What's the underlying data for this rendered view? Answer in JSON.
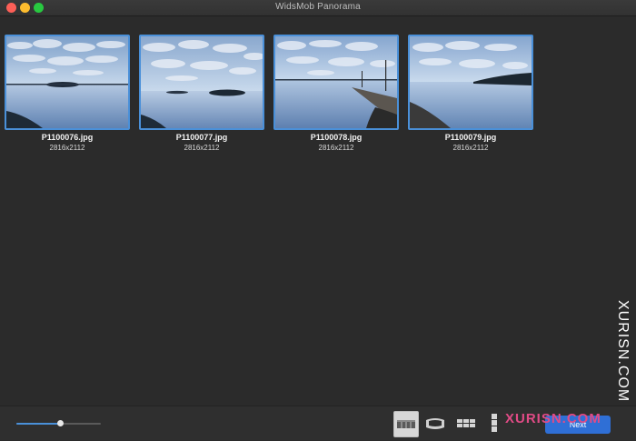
{
  "window": {
    "title": "WidsMob Panorama"
  },
  "photos": [
    {
      "filename": "P1100076.jpg",
      "dimensions": "2816x2112"
    },
    {
      "filename": "P1100077.jpg",
      "dimensions": "2816x2112"
    },
    {
      "filename": "P1100078.jpg",
      "dimensions": "2816x2112"
    },
    {
      "filename": "P1100079.jpg",
      "dimensions": "2816x2112"
    }
  ],
  "toolbar": {
    "thumbnail_size_fraction": 0.52,
    "mode_icons": [
      "flat-panorama-icon",
      "cylindrical-panorama-icon",
      "grid-tile-icon",
      "vertical-panorama-icon"
    ],
    "selected_mode": "flat-panorama-icon",
    "next_label": "Next"
  },
  "watermarks": {
    "side_text": "XURISN.COM",
    "bottom_text": "XURISN.COM"
  },
  "colors": {
    "selection_border": "#4a90d9",
    "accent": "#2f6fd6",
    "background": "#2b2b2b"
  }
}
